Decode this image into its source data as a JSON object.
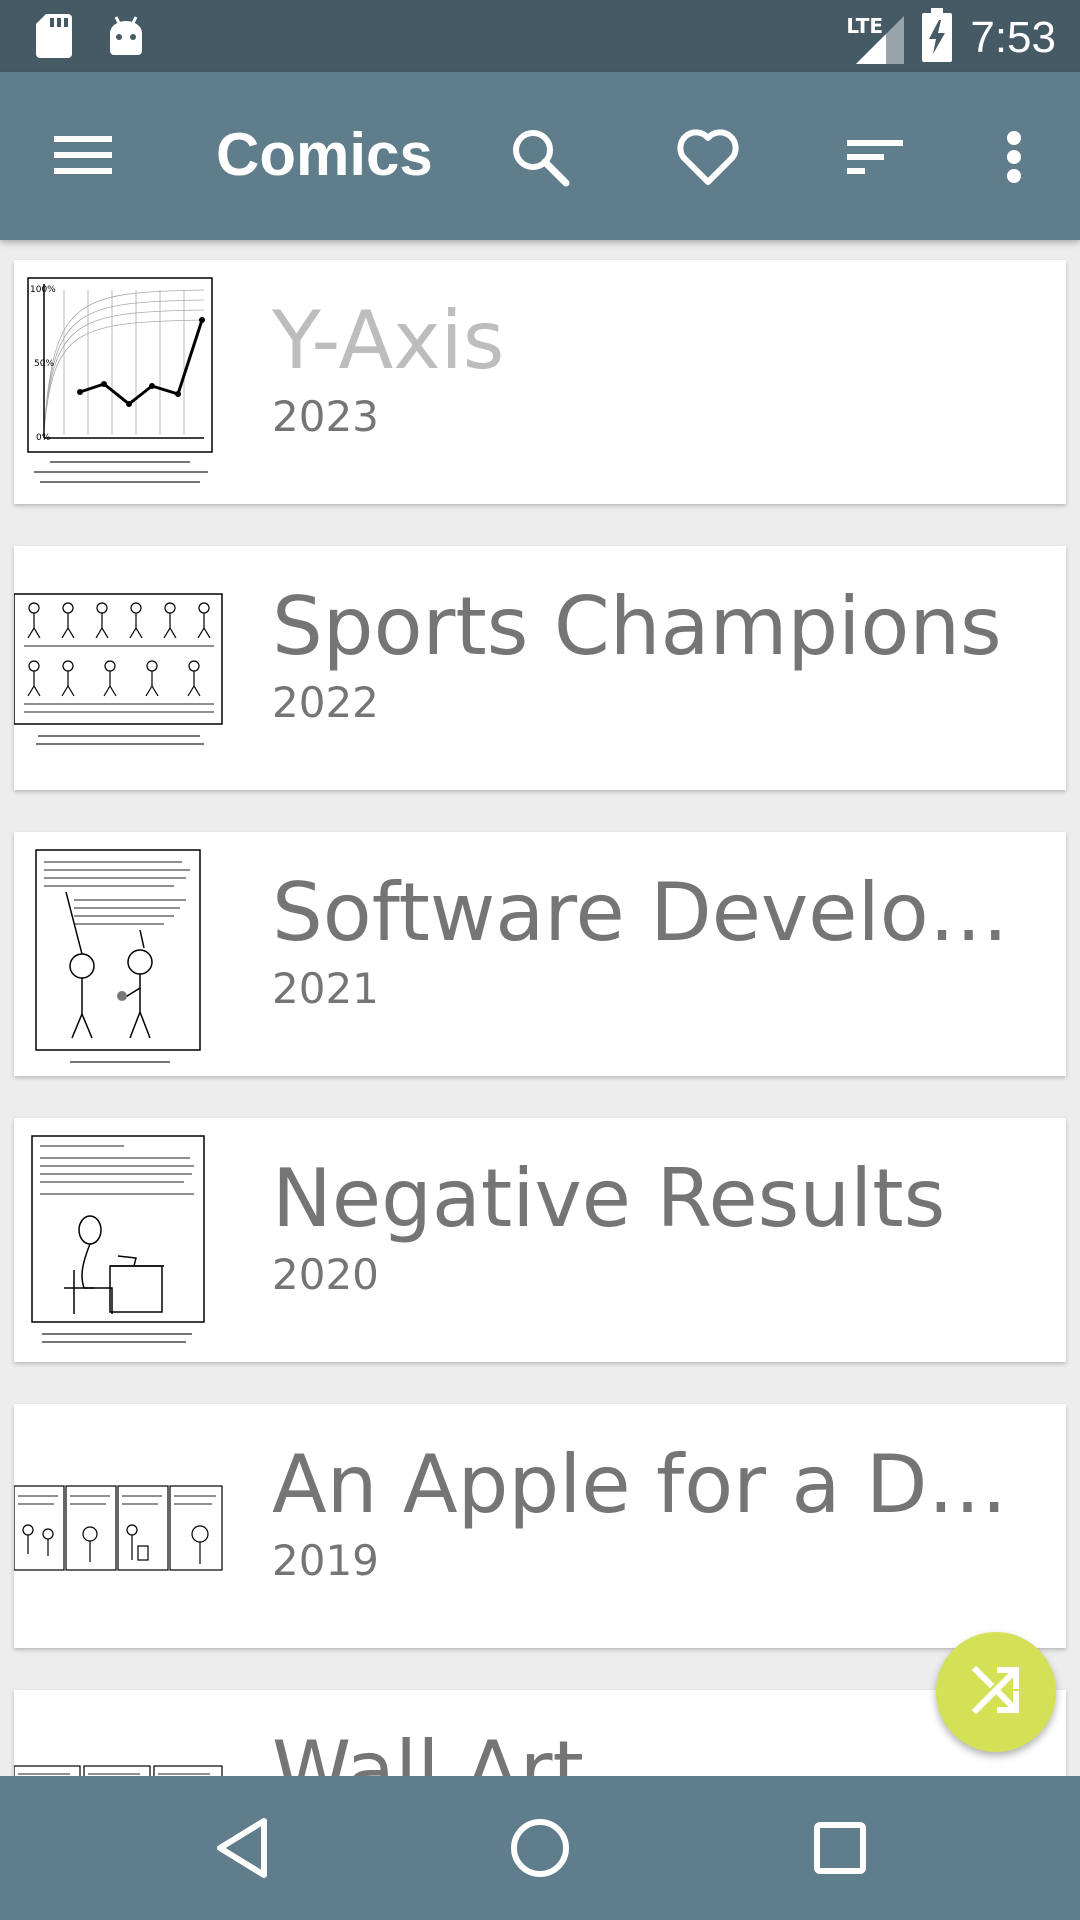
{
  "status_bar": {
    "time": "7:53",
    "network": "LTE",
    "icons": [
      "sd-card-icon",
      "android-icon",
      "lte-signal-icon",
      "battery-charging-icon"
    ]
  },
  "app_bar": {
    "title": "Comics",
    "icons": [
      "menu-icon",
      "search-icon",
      "favorite-icon",
      "sort-icon",
      "more-vert-icon"
    ]
  },
  "comics": [
    {
      "title": "Y-Axis",
      "year": "2023",
      "read": true,
      "thumb": "chart"
    },
    {
      "title": "Sports Champions",
      "year": "2022",
      "read": false,
      "thumb": "grid"
    },
    {
      "title": "Software Development",
      "year": "2021",
      "read": false,
      "thumb": "panel"
    },
    {
      "title": "Negative Results",
      "year": "2020",
      "read": false,
      "thumb": "desk"
    },
    {
      "title": "An Apple for a Dollar",
      "year": "2019",
      "read": false,
      "thumb": "strip"
    },
    {
      "title": "Wall Art",
      "year": "",
      "read": false,
      "thumb": "strip2"
    }
  ],
  "fab": {
    "icon": "shuffle-icon"
  },
  "nav_bar": {
    "icons": [
      "back-icon",
      "home-icon",
      "recents-icon"
    ]
  },
  "colors": {
    "status_bar": "#455a64",
    "app_bar": "#607d8b",
    "fab": "#d4e157",
    "title_text": "#757575",
    "read_title_text": "#bdbdbd"
  }
}
